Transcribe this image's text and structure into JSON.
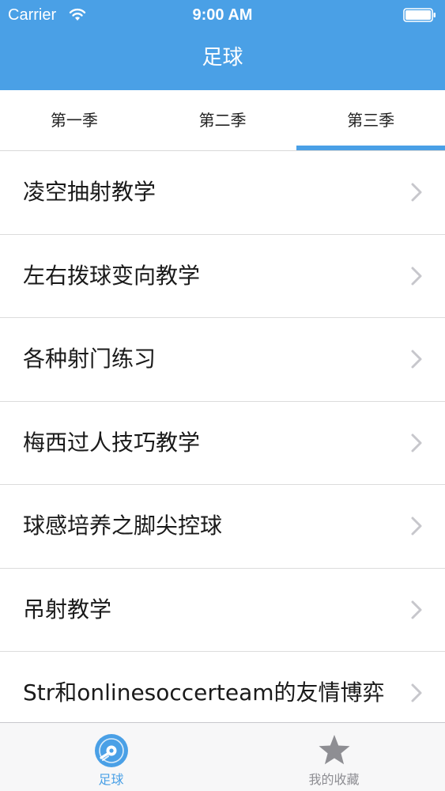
{
  "colors": {
    "accent": "#4aa0e6",
    "tab_inactive": "#8e8e93",
    "chevron": "#c7c7cc"
  },
  "status_bar": {
    "carrier": "Carrier",
    "time": "9:00 AM"
  },
  "nav": {
    "title": "足球"
  },
  "season_tabs": [
    {
      "label": "第一季"
    },
    {
      "label": "第二季"
    },
    {
      "label": "第三季"
    }
  ],
  "selected_season_index": 2,
  "list": {
    "items": [
      {
        "label": "凌空抽射教学"
      },
      {
        "label": "左右拨球变向教学"
      },
      {
        "label": "各种射门练习"
      },
      {
        "label": "梅西过人技巧教学"
      },
      {
        "label": "球感培养之脚尖控球"
      },
      {
        "label": "吊射教学"
      },
      {
        "label": "Str和onlinesoccerteam的友情博弈"
      }
    ],
    "trailing_icon": "chevron-right-icon"
  },
  "tab_bar": {
    "items": [
      {
        "label": "足球",
        "icon": "soccer-disc-icon",
        "active": true
      },
      {
        "label": "我的收藏",
        "icon": "star-icon",
        "active": false
      }
    ]
  }
}
